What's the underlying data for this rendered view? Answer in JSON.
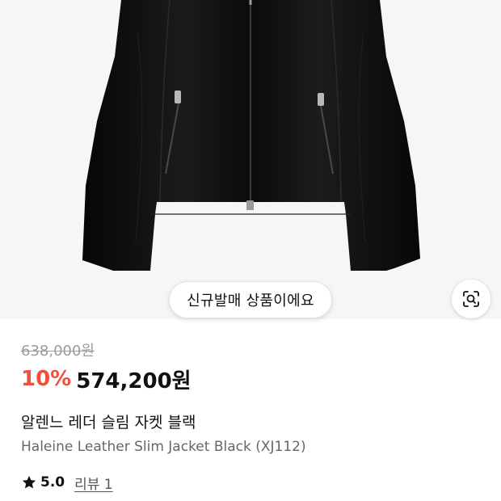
{
  "product": {
    "badge": "신규발매 상품이에요",
    "original_price": "638,000원",
    "discount_rate": "10%",
    "sale_price": "574,200원",
    "name_ko": "알렌느 레더 슬림 자켓 블랙",
    "name_en": "Haleine Leather Slim Jacket Black (XJ112)",
    "rating": "5.0",
    "review_link": "리뷰 1"
  },
  "colors": {
    "discount": "#f04e3e",
    "original_price": "#9b9b9b",
    "jacket": "#111111",
    "image_background": "#f6f6f6"
  },
  "icons": {
    "visual_search": "visual-search-icon",
    "rating": "star-icon"
  }
}
